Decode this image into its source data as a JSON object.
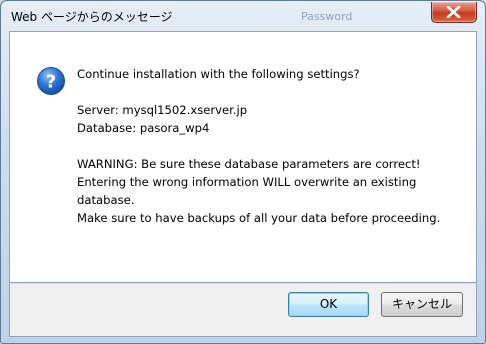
{
  "dialog": {
    "title": "Web ページからのメッセージ",
    "background_title": "Password",
    "icon": "question-icon",
    "message_lines": [
      "Continue installation with the following settings?",
      "",
      "Server: mysql1502.xserver.jp",
      "Database: pasora_wp4",
      "",
      "WARNING: Be sure these database parameters are correct!",
      "Entering the wrong information WILL overwrite an existing",
      "database.",
      "Make sure to have backups of all your data before proceeding."
    ],
    "ok_label": "OK",
    "cancel_label": "キャンセル"
  },
  "colors": {
    "close_button": "#c23a1f",
    "ok_button_border": "#3c7fb1",
    "icon_blue": "#1f5fbf"
  }
}
